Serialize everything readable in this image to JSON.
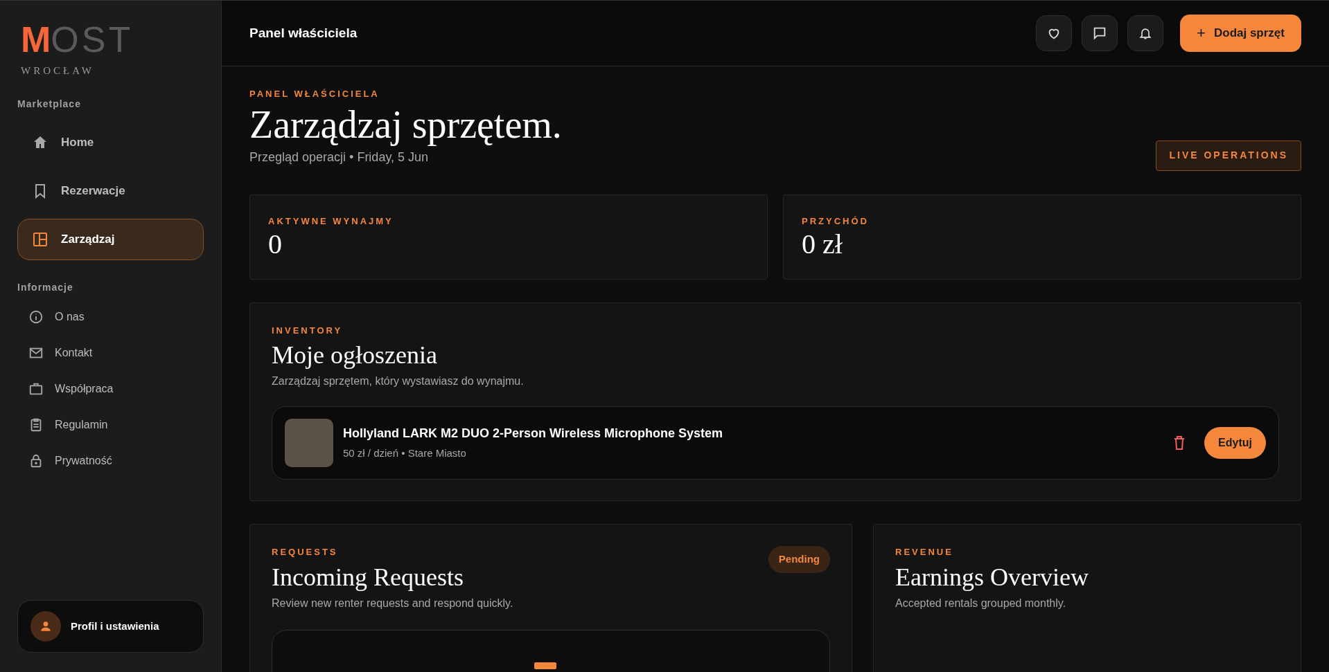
{
  "logo": {
    "accent": "M",
    "rest": "OST",
    "city": "WROCŁAW"
  },
  "sidebar": {
    "sections": [
      {
        "title": "Marketplace",
        "kind": "primary",
        "items": [
          {
            "label": "Home",
            "selected": false
          },
          {
            "label": "Rezerwacje",
            "selected": false
          },
          {
            "label": "Zarządzaj",
            "selected": true
          }
        ]
      },
      {
        "title": "Informacje",
        "kind": "secondary",
        "items": [
          {
            "label": "O nas",
            "selected": false
          },
          {
            "label": "Kontakt",
            "selected": false
          },
          {
            "label": "Współpraca",
            "selected": false
          },
          {
            "label": "Regulamin",
            "selected": false
          },
          {
            "label": "Prywatność",
            "selected": false
          }
        ]
      }
    ],
    "profile": {
      "label": "Profil i ustawienia"
    }
  },
  "header": {
    "title": "Panel właściciela",
    "add_button": {
      "label": "Dodaj sprzęt",
      "icon": "+"
    }
  },
  "hero": {
    "eyebrow": "PANEL WŁAŚCICIELA",
    "title": "Zarządzaj sprzętem.",
    "subtitle": "Przegląd operacji • Friday, 5 Jun",
    "status_button": "LIVE OPERATIONS"
  },
  "stats": [
    {
      "label": "AKTYWNE WYNAJMY",
      "value": "0"
    },
    {
      "label": "PRZYCHÓD",
      "value": "0 zł"
    }
  ],
  "inventory": {
    "eyebrow": "INVENTORY",
    "title": "Moje ogłoszenia",
    "description": "Zarządzaj sprzętem, który wystawiasz do wynajmu.",
    "listings": [
      {
        "title": "Hollyland LARK M2 DUO 2-Person Wireless Microphone System",
        "meta": "50 zł / dzień • Stare Miasto",
        "edit_label": "Edytuj"
      }
    ]
  },
  "requests": {
    "eyebrow": "REQUESTS",
    "title": "Incoming Requests",
    "description": "Review new renter requests and respond quickly.",
    "badge": "Pending"
  },
  "revenue": {
    "eyebrow": "REVENUE",
    "title": "Earnings Overview",
    "description": "Accepted rentals grouped monthly."
  }
}
